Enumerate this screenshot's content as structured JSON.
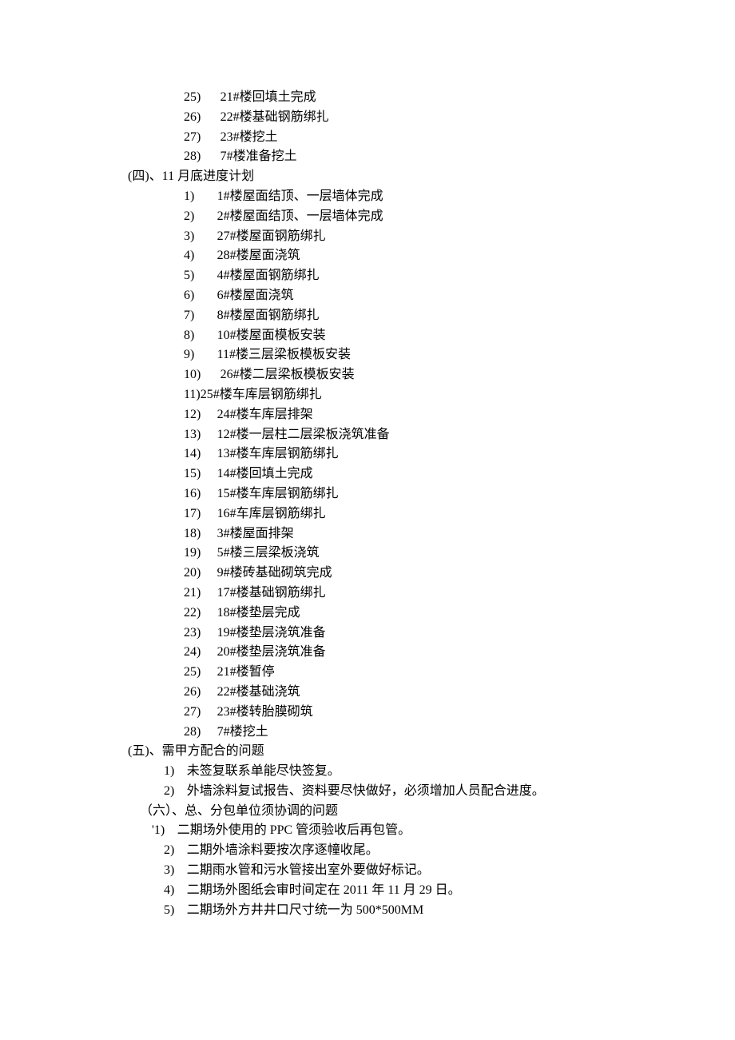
{
  "topBlock": {
    "items": [
      {
        "num": "25)",
        "text": "21#楼回填土完成"
      },
      {
        "num": "26)",
        "text": "22#楼基础钢筋绑扎"
      },
      {
        "num": "27)",
        "text": "23#楼挖土"
      },
      {
        "num": "28)",
        "text": "7#楼准备挖土"
      }
    ]
  },
  "section4": {
    "heading": "(四)、11 月底进度计划",
    "items": [
      {
        "num": "1)",
        "text": "1#楼屋面结顶、一层墙体完成"
      },
      {
        "num": "2)",
        "text": "2#楼屋面结顶、一层墙体完成"
      },
      {
        "num": "3)",
        "text": "27#楼屋面钢筋绑扎"
      },
      {
        "num": "4)",
        "text": "28#楼屋面浇筑"
      },
      {
        "num": "5)",
        "text": "4#楼屋面钢筋绑扎"
      },
      {
        "num": "6)",
        "text": "6#楼屋面浇筑"
      },
      {
        "num": "7)",
        "text": "8#楼屋面钢筋绑扎"
      },
      {
        "num": "8)",
        "text": "10#楼屋面模板安装"
      },
      {
        "num": "9)",
        "text": "11#楼三层梁板模板安装"
      },
      {
        "num": "10)",
        "text": "26#楼二层梁板模板安装",
        "tight": true
      },
      {
        "num": "11)",
        "text": "25#楼车库层钢筋绑扎",
        "tight": true,
        "nospace": true
      },
      {
        "num": "12)",
        "text": "24#楼车库层排架"
      },
      {
        "num": "13)",
        "text": "12#楼一层柱二层梁板浇筑准备"
      },
      {
        "num": "14)",
        "text": "13#楼车库层钢筋绑扎"
      },
      {
        "num": "15)",
        "text": "14#楼回填土完成"
      },
      {
        "num": "16)",
        "text": "15#楼车库层钢筋绑扎"
      },
      {
        "num": "17)",
        "text": "16#车库层钢筋绑扎"
      },
      {
        "num": "18)",
        "text": "3#楼屋面排架"
      },
      {
        "num": "19)",
        "text": "5#楼三层梁板浇筑"
      },
      {
        "num": "20)",
        "text": "9#楼砖基础砌筑完成"
      },
      {
        "num": "21)",
        "text": "17#楼基础钢筋绑扎"
      },
      {
        "num": "22)",
        "text": "18#楼垫层完成"
      },
      {
        "num": "23)",
        "text": "19#楼垫层浇筑准备"
      },
      {
        "num": "24)",
        "text": "20#楼垫层浇筑准备"
      },
      {
        "num": "25)",
        "text": "21#楼暂停"
      },
      {
        "num": "26)",
        "text": "22#楼基础浇筑"
      },
      {
        "num": "27)",
        "text": "23#楼转胎膜砌筑"
      },
      {
        "num": "28)",
        "text": "7#楼挖土"
      }
    ]
  },
  "section5": {
    "heading": "(五)、需甲方配合的问题",
    "items": [
      {
        "num": "1)",
        "text": "未签复联系单能尽快签复。"
      },
      {
        "num": "2)",
        "text": "外墙涂料复试报告、资料要尽快做好，必须增加人员配合进度。"
      }
    ]
  },
  "section6": {
    "heading": "（六）、总、分包单位须协调的问题",
    "leadPrefix": "'",
    "items": [
      {
        "num": "1)",
        "text": "二期场外使用的 PPC 管须验收后再包管。"
      },
      {
        "num": "2)",
        "text": "二期外墙涂料要按次序逐幢收尾。"
      },
      {
        "num": "3)",
        "text": "二期雨水管和污水管接出室外要做好标记。"
      },
      {
        "num": "4)",
        "text": "二期场外图纸会审时间定在 2011 年 11 月 29 日。"
      },
      {
        "num": "5)",
        "text": "二期场外方井井口尺寸统一为 500*500MM"
      }
    ]
  }
}
